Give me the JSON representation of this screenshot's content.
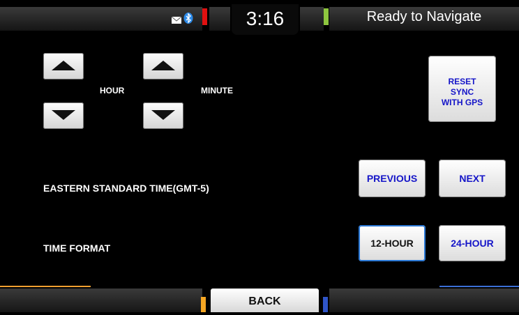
{
  "status_bar": {
    "time": "3:16",
    "title": "Ready to Navigate",
    "icons": [
      "mail-icon",
      "bluetooth-icon"
    ]
  },
  "time_setting": {
    "hour_label": "HOUR",
    "minute_label": "MINUTE",
    "reset_button": [
      "RESET",
      "SYNC",
      "WITH GPS"
    ]
  },
  "time_zone": {
    "label": "EASTERN STANDARD TIME(GMT-5)",
    "previous_label": "PREVIOUS",
    "next_label": "NEXT"
  },
  "time_format": {
    "label": "TIME FORMAT",
    "option_12": "12-HOUR",
    "option_24": "24-HOUR",
    "selected": "12-HOUR"
  },
  "footer": {
    "back_label": "BACK"
  },
  "colors": {
    "accent_blue": "#1515c8",
    "selected_border": "#2a78d6",
    "stripe_red": "#e01010",
    "stripe_green": "#8ec63f",
    "stripe_orange": "#f5a623",
    "stripe_blue": "#2f55c8"
  }
}
